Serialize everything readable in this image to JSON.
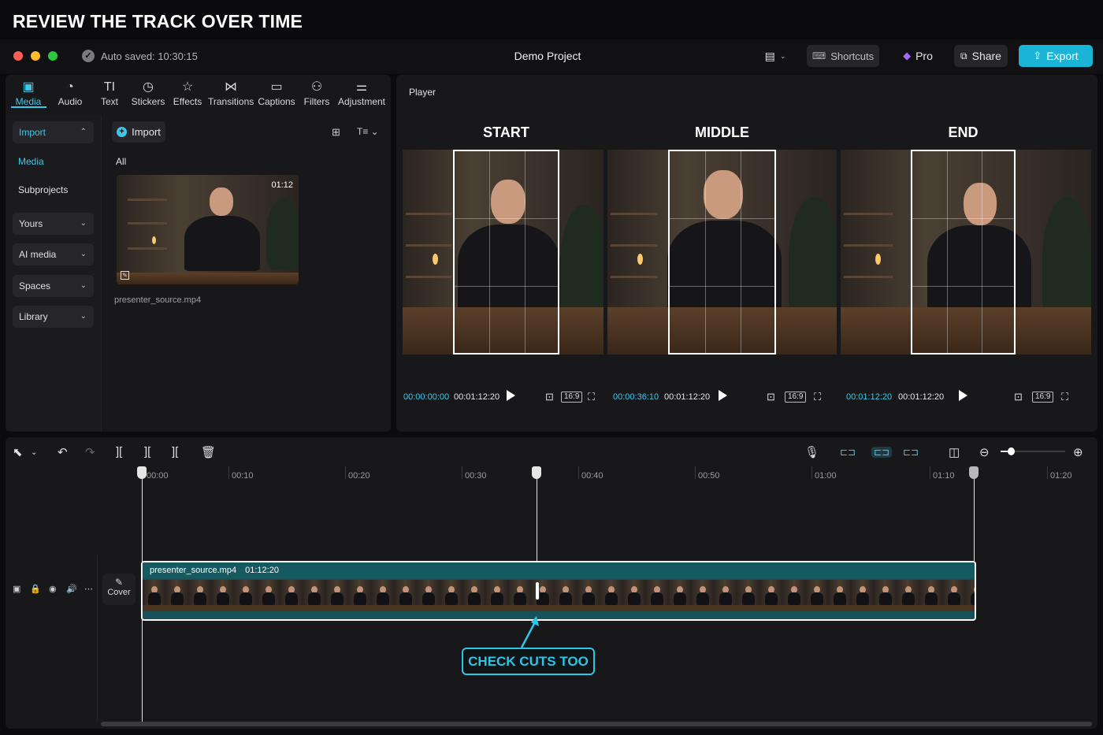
{
  "banner": "REVIEW THE TRACK OVER TIME",
  "titlebar": {
    "autosaved": "Auto saved: 10:30:15",
    "project": "Demo Project",
    "shortcuts": "Shortcuts",
    "pro": "Pro",
    "share": "Share",
    "export": "Export"
  },
  "toolbar": [
    {
      "label": "Media",
      "icon": "media-icon"
    },
    {
      "label": "Audio",
      "icon": "audio-icon"
    },
    {
      "label": "Text",
      "icon": "text-icon"
    },
    {
      "label": "Stickers",
      "icon": "stickers-icon"
    },
    {
      "label": "Effects",
      "icon": "effects-icon"
    },
    {
      "label": "Transitions",
      "icon": "transitions-icon"
    },
    {
      "label": "Captions",
      "icon": "captions-icon"
    },
    {
      "label": "Filters",
      "icon": "filters-icon"
    },
    {
      "label": "Adjustment",
      "icon": "adjustment-icon"
    }
  ],
  "sidebar": {
    "import": "Import",
    "media": "Media",
    "subprojects": "Subprojects",
    "yours": "Yours",
    "ai_media": "AI media",
    "spaces": "Spaces",
    "library": "Library"
  },
  "media_panel": {
    "import_button": "Import",
    "filter_all": "All",
    "clip_duration": "01:12",
    "clip_name": "presenter_source.mp4"
  },
  "player": {
    "title": "Player",
    "views": [
      {
        "label": "START",
        "current": "00:00:00:00",
        "total": "00:01:12:20",
        "ratio": "16:9"
      },
      {
        "label": "MIDDLE",
        "current": "00:00:36:10",
        "total": "00:01:12:20",
        "ratio": "16:9"
      },
      {
        "label": "END",
        "current": "00:01:12:20",
        "total": "00:01:12:20",
        "ratio": "16:9"
      }
    ]
  },
  "timeline": {
    "ruler": [
      "00:00",
      "00:10",
      "00:20",
      "00:30",
      "00:40",
      "00:50",
      "01:00",
      "01:10",
      "01:20"
    ],
    "clip_name": "presenter_source.mp4",
    "clip_duration": "01:12:20",
    "cover": "Cover",
    "callout": "CHECK CUTS TOO"
  },
  "colors": {
    "accent": "#19b4d6",
    "clip": "#17525a",
    "pro": "#9b6cff"
  }
}
